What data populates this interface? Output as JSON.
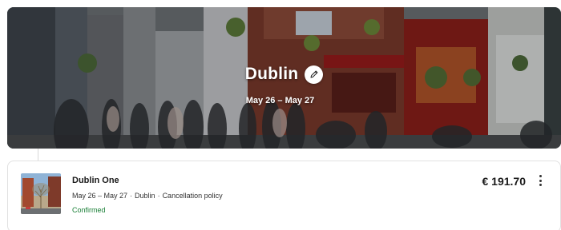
{
  "trip": {
    "destination": "Dublin",
    "dates": "May 26 – May 27"
  },
  "booking": {
    "hotel_name": "Dublin One",
    "dates": "May 26 – May 27",
    "separator": "·",
    "city": "Dublin",
    "policy_link": "Cancellation policy",
    "status": "Confirmed",
    "price": "€ 191.70"
  },
  "icons": {
    "edit": "pencil-icon",
    "more": "more-vertical-icon"
  },
  "colors": {
    "confirmed": "#1a7f37",
    "hero_overlay_text": "#ffffff"
  }
}
